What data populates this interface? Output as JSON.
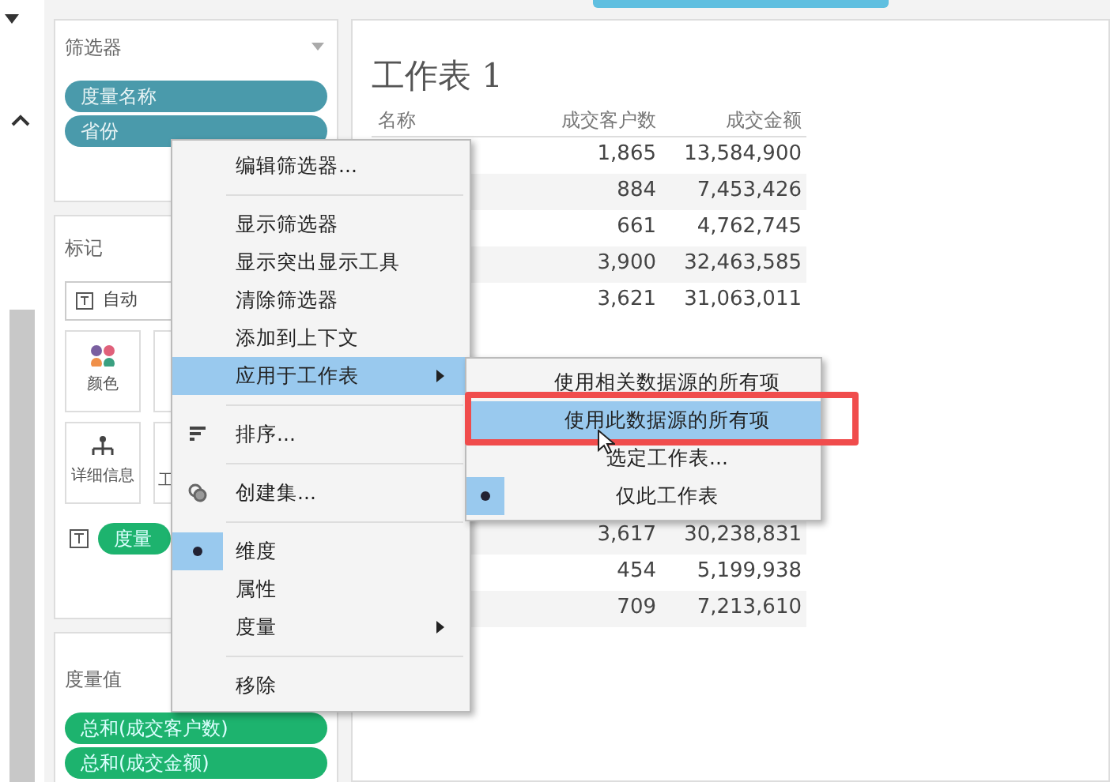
{
  "filters_card": {
    "title": "筛选器",
    "pills": [
      "度量名称",
      "省份"
    ]
  },
  "marks_card": {
    "title": "标记",
    "mark_type": "自动",
    "buttons": [
      {
        "kind": "color",
        "label": "颜色"
      },
      {
        "kind": "blank"
      },
      {
        "kind": "detail",
        "label": "详细信息"
      },
      {
        "kind": "tooltip",
        "label": "工"
      }
    ],
    "text_pill": "度量"
  },
  "measure_values_card": {
    "title": "度量值",
    "pills": [
      "总和(成交客户数)",
      "总和(成交金额)"
    ]
  },
  "sheet": {
    "title": "工作表 1",
    "columns": [
      "名称",
      "成交客户数",
      "成交金额"
    ],
    "rows": [
      {
        "values": [
          "1,865",
          "13,584,900"
        ]
      },
      {
        "values": [
          "884",
          "7,453,426"
        ]
      },
      {
        "values": [
          "661",
          "4,762,745"
        ]
      },
      {
        "values": [
          "3,900",
          "32,463,585"
        ]
      },
      {
        "values": [
          "3,621",
          "31,063,011"
        ]
      },
      {
        "values": [
          "3,617",
          "30,238,831"
        ]
      },
      {
        "values": [
          "454",
          "5,199,938"
        ]
      },
      {
        "values": [
          "709",
          "7,213,610"
        ]
      }
    ]
  },
  "context_menu": [
    {
      "kind": "item",
      "label": "编辑筛选器...",
      "highlighted": false
    },
    {
      "kind": "separator"
    },
    {
      "kind": "item",
      "label": "显示筛选器",
      "highlighted": false
    },
    {
      "kind": "item",
      "label": "显示突出显示工具",
      "highlighted": false
    },
    {
      "kind": "item",
      "label": "清除筛选器",
      "highlighted": false
    },
    {
      "kind": "item",
      "label": "添加到上下文",
      "highlighted": false
    },
    {
      "kind": "submenu",
      "label": "应用于工作表",
      "highlighted": true
    },
    {
      "kind": "separator"
    },
    {
      "kind": "sort",
      "label": "排序...",
      "highlighted": false
    },
    {
      "kind": "separator"
    },
    {
      "kind": "set",
      "label": "创建集...",
      "highlighted": false
    },
    {
      "kind": "separator"
    },
    {
      "kind": "radio",
      "label": "维度",
      "selected": true
    },
    {
      "kind": "radio",
      "label": "属性",
      "selected": false
    },
    {
      "kind": "submenu",
      "label": "度量",
      "highlighted": false
    },
    {
      "kind": "separator"
    },
    {
      "kind": "item",
      "label": "移除",
      "highlighted": false
    }
  ],
  "submenu": [
    {
      "label": "使用相关数据源的所有项",
      "highlighted": false,
      "selected": false
    },
    {
      "label": "使用此数据源的所有项",
      "highlighted": true,
      "selected": false
    },
    {
      "label": "选定工作表...",
      "highlighted": false,
      "selected": false
    },
    {
      "label": "仅此工作表",
      "highlighted": false,
      "selected": true
    }
  ]
}
